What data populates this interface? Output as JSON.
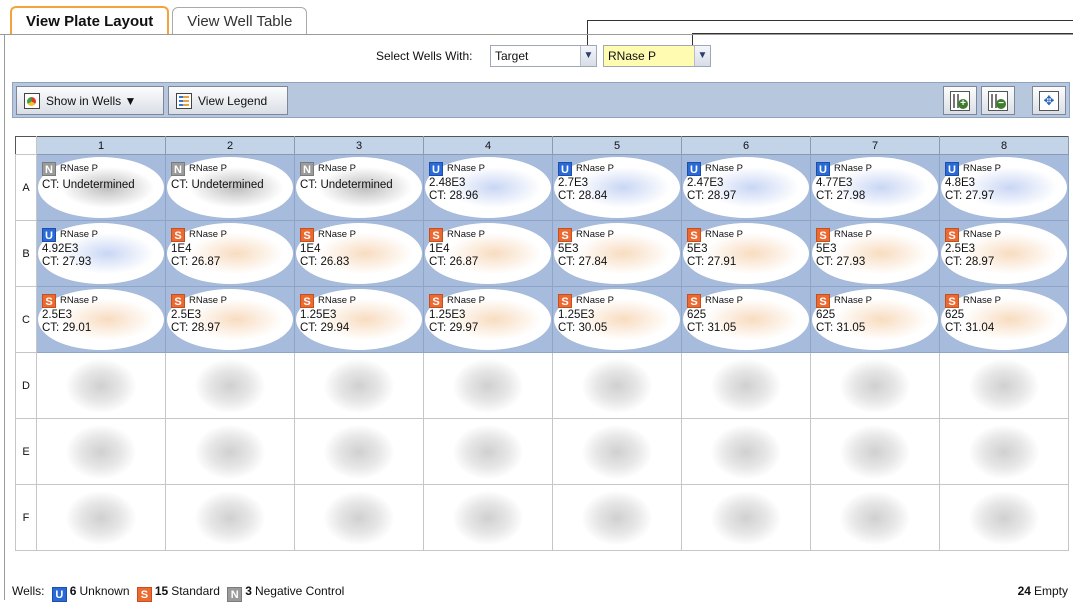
{
  "tabs": [
    {
      "label": "View Plate Layout",
      "active": true
    },
    {
      "label": "View Well Table",
      "active": false
    }
  ],
  "select_wells": {
    "label": "Select Wells With:",
    "category": "Target",
    "value": "RNase P"
  },
  "toolbar": {
    "show_in_wells": "Show in Wells ▼",
    "view_legend": "View Legend",
    "zoom_in_icon": "zoom-in-grid-icon",
    "zoom_out_icon": "zoom-out-grid-icon",
    "fit_icon": "fit-to-window-icon"
  },
  "columns": [
    "1",
    "2",
    "3",
    "4",
    "5",
    "6",
    "7",
    "8"
  ],
  "rows": [
    {
      "label": "A",
      "wells": [
        {
          "task": "N",
          "target": "RNase P",
          "qty": "",
          "ct": "CT: Undetermined"
        },
        {
          "task": "N",
          "target": "RNase P",
          "qty": "",
          "ct": "CT: Undetermined"
        },
        {
          "task": "N",
          "target": "RNase P",
          "qty": "",
          "ct": "CT: Undetermined"
        },
        {
          "task": "U",
          "target": "RNase P",
          "qty": "2.48E3",
          "ct": "CT: 28.96"
        },
        {
          "task": "U",
          "target": "RNase P",
          "qty": "2.7E3",
          "ct": "CT: 28.84"
        },
        {
          "task": "U",
          "target": "RNase P",
          "qty": "2.47E3",
          "ct": "CT: 28.97"
        },
        {
          "task": "U",
          "target": "RNase P",
          "qty": "4.77E3",
          "ct": "CT: 27.98"
        },
        {
          "task": "U",
          "target": "RNase P",
          "qty": "4.8E3",
          "ct": "CT: 27.97"
        }
      ]
    },
    {
      "label": "B",
      "wells": [
        {
          "task": "U",
          "target": "RNase P",
          "qty": "4.92E3",
          "ct": "CT: 27.93"
        },
        {
          "task": "S",
          "target": "RNase P",
          "qty": "1E4",
          "ct": "CT: 26.87"
        },
        {
          "task": "S",
          "target": "RNase P",
          "qty": "1E4",
          "ct": "CT: 26.83"
        },
        {
          "task": "S",
          "target": "RNase P",
          "qty": "1E4",
          "ct": "CT: 26.87"
        },
        {
          "task": "S",
          "target": "RNase P",
          "qty": "5E3",
          "ct": "CT: 27.84"
        },
        {
          "task": "S",
          "target": "RNase P",
          "qty": "5E3",
          "ct": "CT: 27.91"
        },
        {
          "task": "S",
          "target": "RNase P",
          "qty": "5E3",
          "ct": "CT: 27.93"
        },
        {
          "task": "S",
          "target": "RNase P",
          "qty": "2.5E3",
          "ct": "CT: 28.97"
        }
      ]
    },
    {
      "label": "C",
      "wells": [
        {
          "task": "S",
          "target": "RNase P",
          "qty": "2.5E3",
          "ct": "CT: 29.01"
        },
        {
          "task": "S",
          "target": "RNase P",
          "qty": "2.5E3",
          "ct": "CT: 28.97"
        },
        {
          "task": "S",
          "target": "RNase P",
          "qty": "1.25E3",
          "ct": "CT: 29.94"
        },
        {
          "task": "S",
          "target": "RNase P",
          "qty": "1.25E3",
          "ct": "CT: 29.97"
        },
        {
          "task": "S",
          "target": "RNase P",
          "qty": "1.25E3",
          "ct": "CT: 30.05"
        },
        {
          "task": "S",
          "target": "RNase P",
          "qty": "625",
          "ct": "CT: 31.05"
        },
        {
          "task": "S",
          "target": "RNase P",
          "qty": "625",
          "ct": "CT: 31.05"
        },
        {
          "task": "S",
          "target": "RNase P",
          "qty": "625",
          "ct": "CT: 31.04"
        }
      ]
    },
    {
      "label": "D",
      "wells": []
    },
    {
      "label": "E",
      "wells": []
    },
    {
      "label": "F",
      "wells": []
    }
  ],
  "status": {
    "prefix": "Wells:",
    "unknown_count": "6",
    "unknown_label": "Unknown",
    "standard_count": "15",
    "standard_label": "Standard",
    "negative_count": "3",
    "negative_label": "Negative Control",
    "empty_count": "24",
    "empty_label": "Empty"
  },
  "task_colors": {
    "U": "#2a6ad8",
    "S": "#ea6a32",
    "N": "#9b9b9b"
  }
}
